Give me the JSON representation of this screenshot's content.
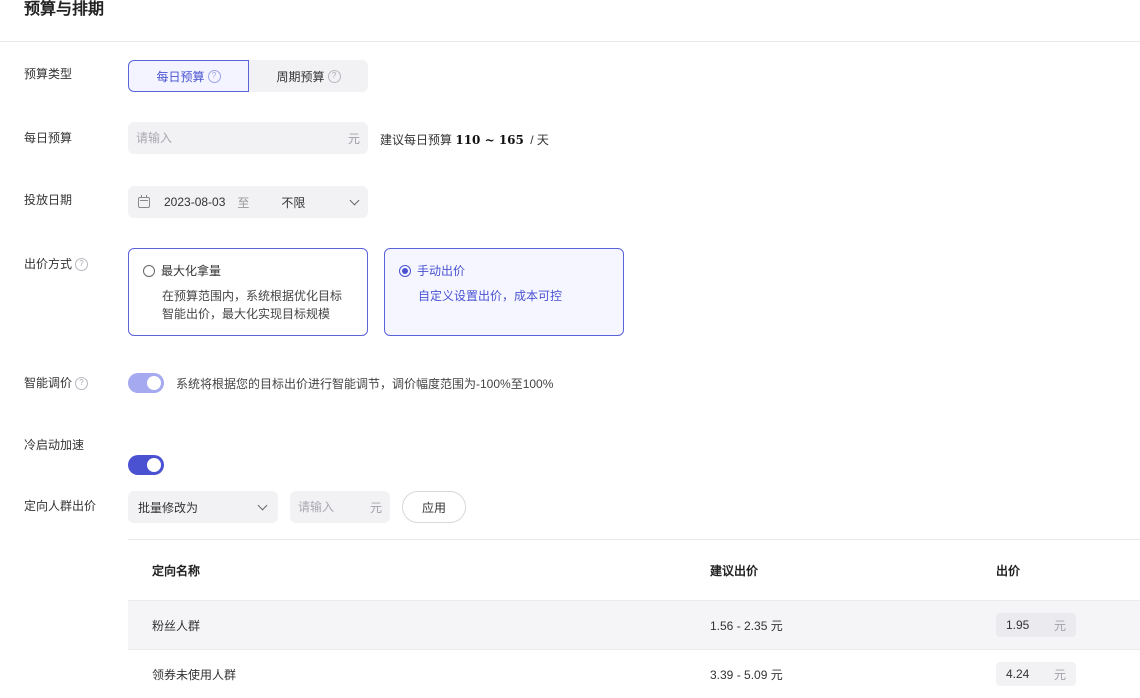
{
  "header": {
    "title": "预算与排期"
  },
  "budget_type": {
    "label": "预算类型",
    "options": [
      {
        "label": "每日预算",
        "selected": true
      },
      {
        "label": "周期预算",
        "selected": false
      }
    ]
  },
  "daily_budget": {
    "label": "每日预算",
    "placeholder": "请输入",
    "unit": "元",
    "suggest_prefix": "建议每日预算",
    "suggest_range": "110 ~ 165",
    "suggest_suffix": "/ 天"
  },
  "schedule": {
    "label": "投放日期",
    "start_date": "2023-08-03",
    "separator": "至",
    "end_value": "不限"
  },
  "bid_method": {
    "label": "出价方式",
    "options": [
      {
        "title": "最大化拿量",
        "desc": "在预算范围内，系统根据优化目标智能出价，最大化实现目标规模",
        "selected": false
      },
      {
        "title": "手动出价",
        "desc": "自定义设置出价，成本可控",
        "selected": true
      }
    ]
  },
  "smart_adjust": {
    "label": "智能调价",
    "enabled": true,
    "description": "系统将根据您的目标出价进行智能调节，调价幅度范围为-100%至100%"
  },
  "cold_start": {
    "label": "冷启动加速",
    "enabled": true
  },
  "audience_bid": {
    "label": "定向人群出价",
    "batch_select": "批量修改为",
    "batch_input_placeholder": "请输入",
    "batch_unit": "元",
    "apply_label": "应用",
    "columns": [
      "定向名称",
      "建议出价",
      "出价"
    ],
    "rows": [
      {
        "name": "粉丝人群",
        "suggested": "1.56 - 2.35 元",
        "bid": "1.95",
        "unit": "元"
      },
      {
        "name": "领券未使用人群",
        "suggested": "3.39 - 5.09 元",
        "bid": "4.24",
        "unit": "元"
      }
    ]
  },
  "colors": {
    "accent": "#4a52d2",
    "accent_light": "#a5a9ef",
    "input_bg": "#f2f2f5"
  }
}
